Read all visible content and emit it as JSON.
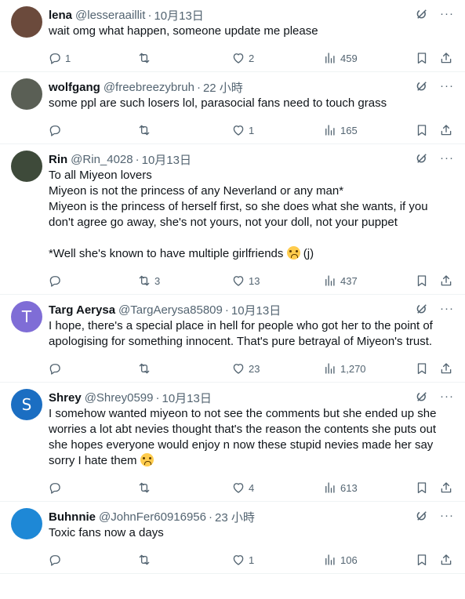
{
  "tweets": [
    {
      "name": "lena",
      "handle": "@lesseraaillit",
      "time": "10月13日",
      "lines": [
        "wait omg what happen, someone update me please"
      ],
      "replies": "1",
      "retweets": "",
      "likes": "2",
      "views": "459",
      "avatar_color": "#6b4a3c",
      "avatar_letter": ""
    },
    {
      "name": "wolfgang",
      "handle": "@freebreezybruh",
      "time": "22 小時",
      "lines": [
        "some ppl are such losers lol, parasocial fans need to touch grass"
      ],
      "replies": "",
      "retweets": "",
      "likes": "1",
      "views": "165",
      "avatar_color": "#5a5f55",
      "avatar_letter": ""
    },
    {
      "name": "Rin",
      "handle": "@Rin_4028",
      "time": "10月13日",
      "lines": [
        "To all Miyeon lovers",
        "Miyeon is not the princess of any Neverland or any man*",
        "Miyeon is the princess of herself first, so she does what she wants, if you don't agree go away, she's not yours, not your doll, not your puppet",
        "",
        "*Well she's known to have multiple girlfriends",
        "(j)"
      ],
      "replies": "",
      "retweets": "3",
      "likes": "13",
      "views": "437",
      "avatar_color": "#3e4a3a",
      "avatar_letter": ""
    },
    {
      "name": "Targ Aerysa",
      "handle": "@TargAerysa85809",
      "time": "10月13日",
      "lines": [
        "I hope, there's a special place in hell for people who got her to the point of apologising for something innocent. That's pure betrayal of Miyeon's trust."
      ],
      "replies": "",
      "retweets": "",
      "likes": "23",
      "views": "1,270",
      "avatar_color": "#7f6dd6",
      "avatar_letter": "T"
    },
    {
      "name": "Shrey",
      "handle": "@Shrey0599",
      "time": "10月13日",
      "lines": [
        "I somehow wanted miyeon to not see the comments but she ended up she worries a lot abt nevies thought that's the reason the contents she puts out she hopes everyone would enjoy n now these stupid nevies made her say sorry I hate them"
      ],
      "replies": "",
      "retweets": "",
      "likes": "4",
      "views": "613",
      "avatar_color": "#1b6ec2",
      "avatar_letter": "S"
    },
    {
      "name": "Buhnnie",
      "handle": "@JohnFer60916956",
      "time": "23 小時",
      "lines": [
        "Toxic fans now a days"
      ],
      "replies": "",
      "retweets": "",
      "likes": "1",
      "views": "106",
      "avatar_color": "#1e88d6",
      "avatar_letter": ""
    }
  ],
  "icons": {
    "reply": "reply-icon",
    "retweet": "retweet-icon",
    "like": "heart-icon",
    "views": "views-icon",
    "bookmark": "bookmark-icon",
    "share": "share-icon",
    "grok": "grok-icon",
    "more": "more-icon",
    "emoji": "loudly-crying-face-emoji"
  },
  "more_glyph": "···"
}
